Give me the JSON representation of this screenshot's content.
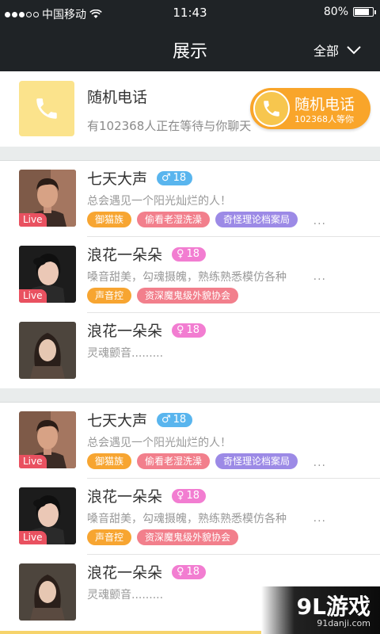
{
  "status_bar": {
    "carrier": "中国移动",
    "time": "11:43",
    "battery": "80%",
    "battery_level": 0.8
  },
  "nav": {
    "title": "展示",
    "filter_label": "全部"
  },
  "random_call": {
    "title": "随机电话",
    "subtitle": "有102368人正在等待与你聊天",
    "button_label": "随机电话",
    "button_sub": "102368人等你"
  },
  "groups": [
    {
      "users": [
        {
          "name": "七天大声",
          "gender": "♂",
          "age": "18",
          "live": "Live",
          "bio": "总会遇见一个阳光灿烂的人！",
          "tags": [
            "御猫族",
            "偷看老湿洗澡",
            "奇怪理论档案局"
          ],
          "more": "..."
        },
        {
          "name": "浪花一朵朵",
          "gender": "♀",
          "age": "18",
          "live": "Live",
          "bio": "嗓音甜美，勾魂摄魄，熟练熟悉模仿各种",
          "tags": [
            "声音控",
            "资深魔鬼级外貌协会"
          ],
          "more": "..."
        },
        {
          "name": "浪花一朵朵",
          "gender": "♀",
          "age": "18",
          "bio": "灵魂颤音........."
        }
      ]
    },
    {
      "users": [
        {
          "name": "七天大声",
          "gender": "♂",
          "age": "18",
          "live": "Live",
          "bio": "总会遇见一个阳光灿烂的人！",
          "tags": [
            "御猫族",
            "偷看老湿洗澡",
            "奇怪理论档案局"
          ],
          "more": "..."
        },
        {
          "name": "浪花一朵朵",
          "gender": "♀",
          "age": "18",
          "live": "Live",
          "bio": "嗓音甜美，勾魂摄魄，熟练熟悉模仿各种",
          "tags": [
            "声音控",
            "资深魔鬼级外貌协会"
          ],
          "more": "..."
        },
        {
          "name": "浪花一朵朵",
          "gender": "♀",
          "age": "18",
          "bio": "灵魂颤音........."
        }
      ]
    }
  ],
  "watermark": {
    "logo": "9L游戏",
    "url": "91danji.com"
  },
  "colors": {
    "header": "#1f2326",
    "accent_orange": "#f9a52a",
    "male": "#59b5ee",
    "female": "#f27dd1",
    "live": "#e95160"
  }
}
